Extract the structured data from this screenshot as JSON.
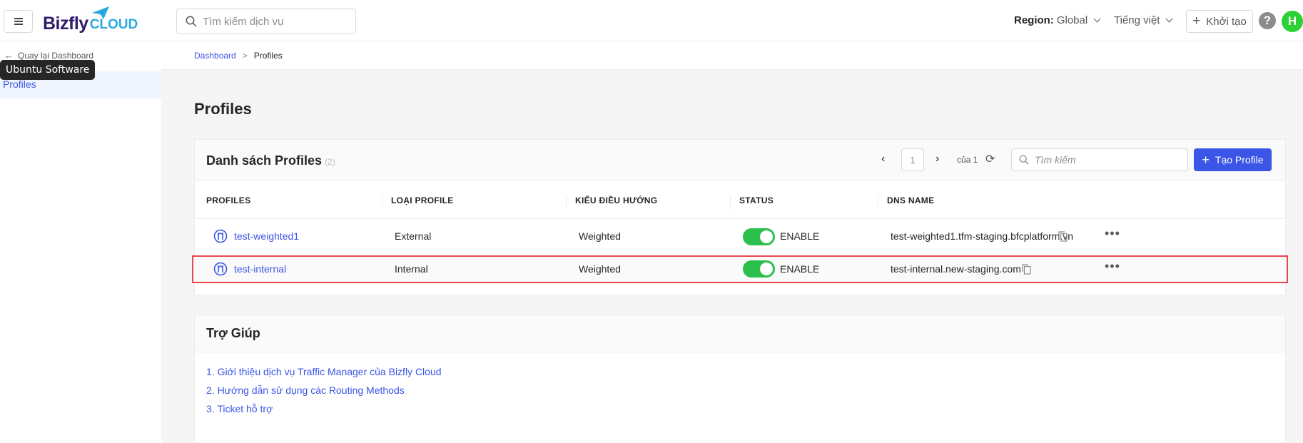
{
  "topbar": {
    "logo_main": "Bizfly",
    "logo_sub": "CLOUD",
    "search_placeholder": "Tìm kiếm dịch vụ",
    "region_label": "Region:",
    "region_value": "Global",
    "language": "Tiếng việt",
    "create_label": "Khởi tạo",
    "help_glyph": "?",
    "avatar_initial": "H"
  },
  "sidebar": {
    "back_label": "Quay lại Dashboard",
    "tooltip": "Ubuntu Software",
    "active_item": "Profiles"
  },
  "breadcrumb": {
    "root": "Dashboard",
    "separator": ">",
    "current": "Profiles"
  },
  "page": {
    "title": "Profiles"
  },
  "profiles_card": {
    "title": "Danh sách Profiles",
    "count": "(2)",
    "page_number": "1",
    "page_of": "của 1",
    "search_placeholder": "Tìm kiếm",
    "create_button": "Tạo Profile",
    "columns": [
      "PROFILES",
      "LOẠI PROFILE",
      "KIỂU ĐIỀU HƯỚNG",
      "STATUS",
      "DNS NAME"
    ],
    "rows": [
      {
        "name": "test-weighted1",
        "type": "External",
        "routing": "Weighted",
        "status": "ENABLE",
        "enabled": true,
        "dns": "test-weighted1.tfm-staging.bfcplatform.vn"
      },
      {
        "name": "test-internal",
        "type": "Internal",
        "routing": "Weighted",
        "status": "ENABLE",
        "enabled": true,
        "dns": "test-internal.new-staging.com"
      }
    ],
    "more_glyph": "•••"
  },
  "help_card": {
    "title": "Trợ Giúp",
    "links": [
      "1. Giới thiệu dịch vụ Traffic Manager của Bizfly Cloud",
      "2. Hướng dẫn sử dụng các Routing Methods",
      "3. Ticket hỗ trợ"
    ]
  },
  "colors": {
    "primary": "#3b55e6",
    "toggle_on": "#2bbf4e",
    "highlight": "#e8464f",
    "avatar": "#2bd135"
  }
}
